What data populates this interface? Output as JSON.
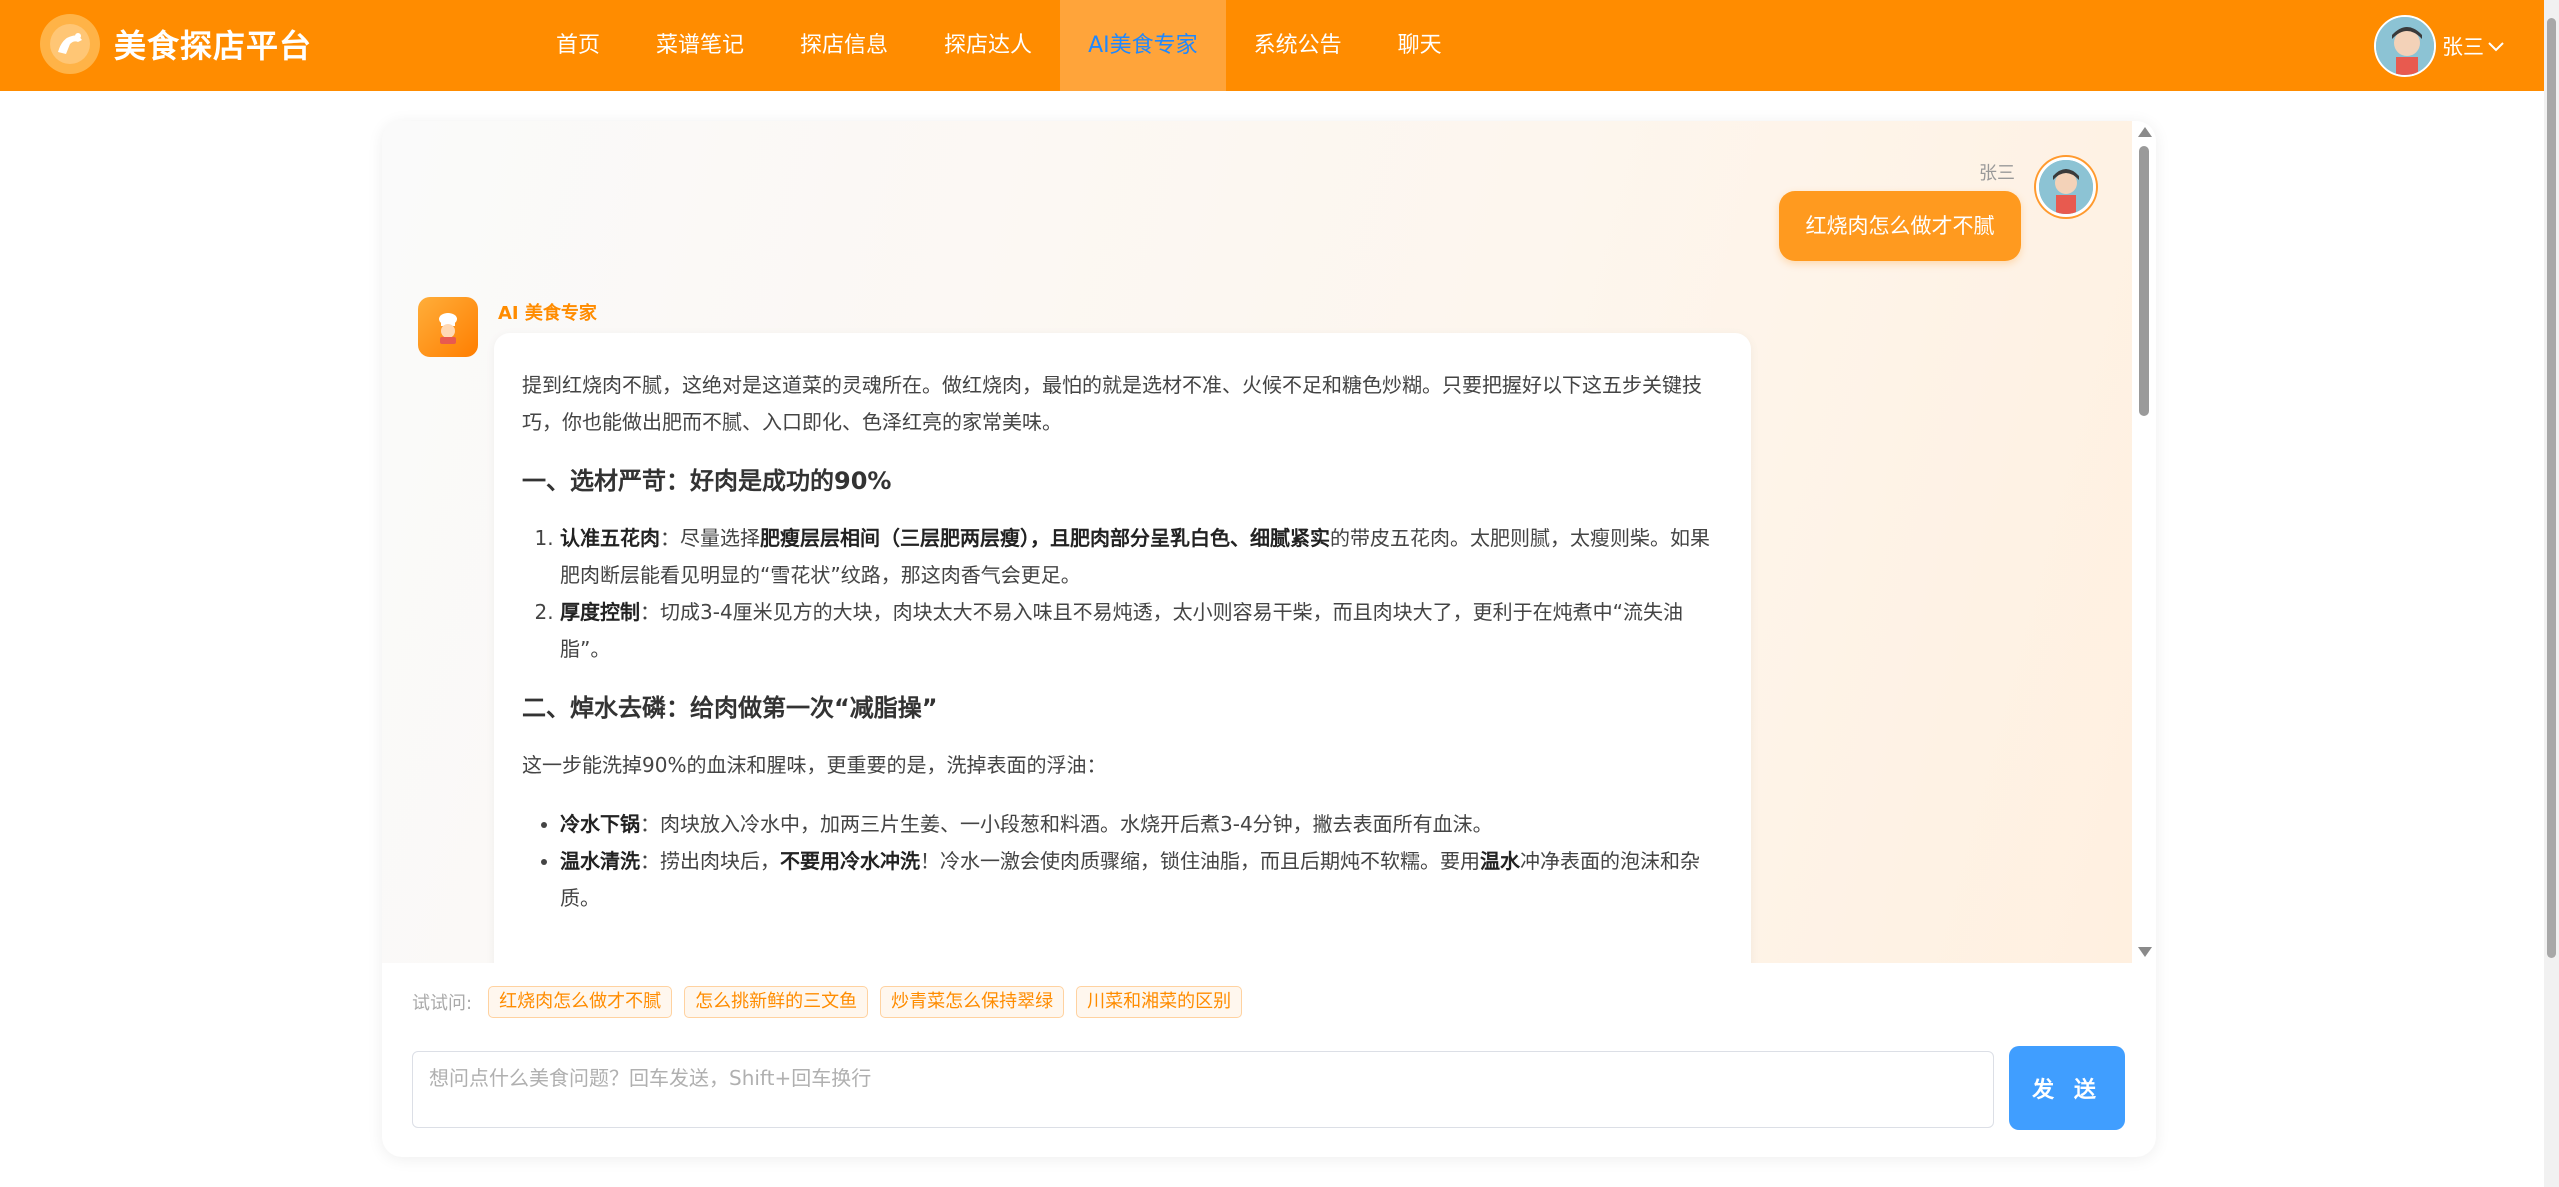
{
  "header": {
    "brand": "美食探店平台",
    "nav": [
      {
        "label": "首页"
      },
      {
        "label": "菜谱笔记"
      },
      {
        "label": "探店信息"
      },
      {
        "label": "探店达人"
      },
      {
        "label": "AI美食专家",
        "active": true
      },
      {
        "label": "系统公告"
      },
      {
        "label": "聊天"
      }
    ],
    "user": {
      "name": "张三"
    }
  },
  "chat": {
    "user_message": {
      "name": "张三",
      "text": "红烧肉怎么做才不腻"
    },
    "ai_message": {
      "name": "AI 美食专家",
      "intro": "提到红烧肉不腻，这绝对是这道菜的灵魂所在。做红烧肉，最怕的就是选材不准、火候不足和糖色炒糊。只要把握好以下这五步关键技巧，你也能做出肥而不腻、入口即化、色泽红亮的家常美味。",
      "section1": {
        "heading": "一、选材严苛：好肉是成功的90%",
        "items": [
          {
            "bold": "认准五花肉",
            "t1": "：尽量选择",
            "bold2": "肥瘦层层相间（三层肥两层瘦），且肥肉部分呈乳白色、细腻紧实",
            "t2": "的带皮五花肉。太肥则腻，太瘦则柴。如果肥肉断层能看见明显的“雪花状”纹路，那这肉香气会更足。"
          },
          {
            "bold": "厚度控制",
            "t1": "：切成3-4厘米见方的大块，肉块太大不易入味且不易炖透，太小则容易干柴，而且肉块大了，更利于在炖煮中“流失油脂”。"
          }
        ]
      },
      "section2": {
        "heading": "二、焯水去磷：给肉做第一次“减脂操”",
        "lead": "这一步能洗掉90%的血沫和腥味，更重要的是，洗掉表面的浮油：",
        "items": [
          {
            "bold": "冷水下锅",
            "t1": "：肉块放入冷水中，加两三片生姜、一小段葱和料酒。水烧开后煮3-4分钟，撇去表面所有血沫。"
          },
          {
            "bold": "温水清洗",
            "t1": "：捞出肉块后，",
            "bold2": "不要用冷水冲洗",
            "t2": "！冷水一激会使肉质骤缩，锁住油脂，而且后期炖不软糯。要用",
            "bold3": "温水",
            "t3": "冲净表面的泡沫和杂质。"
          }
        ]
      }
    }
  },
  "suggestions": {
    "label": "试试问:",
    "chips": [
      "红烧肉怎么做才不腻",
      "怎么挑新鲜的三文鱼",
      "炒青菜怎么保持翠绿",
      "川菜和湘菜的区别"
    ]
  },
  "composer": {
    "placeholder": "想问点什么美食问题？回车发送，Shift+回车换行",
    "send_label": "发 送"
  },
  "colors": {
    "brand": "#ff8c00",
    "nav_active_text": "#1e88ff",
    "send": "#409eff"
  }
}
